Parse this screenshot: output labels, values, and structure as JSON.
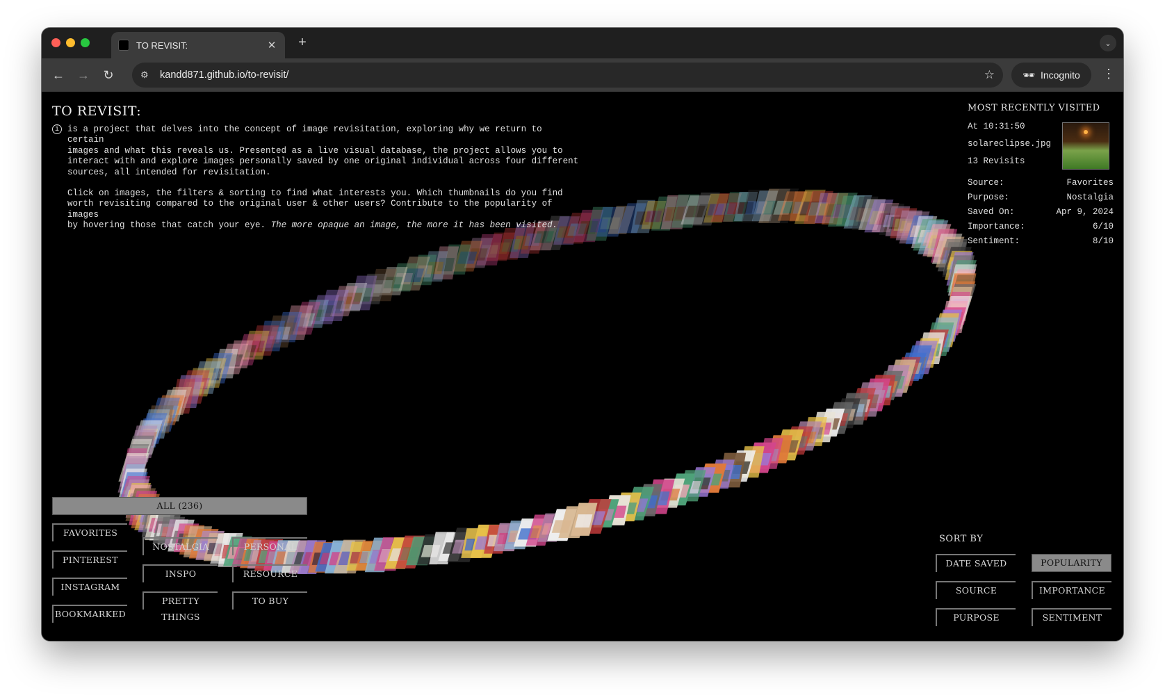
{
  "browser": {
    "tab_title": "TO REVISIT:",
    "url": "kandd871.github.io/to-revisit/",
    "incognito_label": "Incognito",
    "icons": [
      "close-icon",
      "plus-icon",
      "chevron-down-icon",
      "back-arrow-icon",
      "forward-arrow-icon",
      "reload-icon",
      "site-info-icon",
      "star-icon",
      "incognito-icon",
      "kebab-menu-icon"
    ]
  },
  "page": {
    "title": "TO REVISIT:",
    "intro_p1": "is a project that delves into the concept of image revisitation, exploring why we return to certain\nimages and what this reveals us. Presented as a live visual database, the project allows you to\ninteract with and explore images personally saved by one original individual across four different\nsources, all intended for revisitation.",
    "intro_p2": "Click on images, the filters & sorting to find what interests you. Which thumbnails do you find\nworth revisiting compared to the original user & other users? Contribute to the popularity of images\nby hovering those that catch your eye.",
    "intro_p2_italic": "The more opaque an image, the more it has been visited."
  },
  "recent": {
    "heading": "MOST RECENTLY VISITED",
    "time": "At 10:31:50",
    "filename": "solareclipse.jpg",
    "revisits": "13 Revisits",
    "fields": [
      {
        "label": "Source:",
        "value": "Favorites"
      },
      {
        "label": "Purpose:",
        "value": "Nostalgia"
      },
      {
        "label": "Saved On:",
        "value": "Apr 9, 2024"
      },
      {
        "label": "Importance:",
        "value": "6/10"
      },
      {
        "label": "Sentiment:",
        "value": "8/10"
      }
    ]
  },
  "filters": {
    "all": "ALL (236)",
    "sources": [
      "FAVORITES",
      "PINTEREST",
      "INSTAGRAM",
      "BOOKMARKED"
    ],
    "purposes": [
      "NOSTALGIA",
      "PERSONAL",
      "INSPO",
      "RESOURCE",
      "PRETTY THINGS",
      "TO BUY"
    ]
  },
  "sort": {
    "heading": "SORT BY",
    "options": [
      "DATE SAVED",
      "POPULARITY",
      "SOURCE",
      "IMPORTANCE",
      "PURPOSE",
      "SENTIMENT"
    ],
    "active": "POPULARITY"
  },
  "colors": {
    "tabstrip": "#1f1f1f",
    "toolbar": "#3b3b3b",
    "omnibox": "#282828",
    "page_bg": "#000000",
    "active_button": "#8a8a8a",
    "traffic_red": "#ff5f57",
    "traffic_yellow": "#febc2e",
    "traffic_green": "#28c840",
    "thumbnail_palette": [
      "#d4468c",
      "#e9e4d8",
      "#3f6fd1",
      "#c23b3b",
      "#e8c24a",
      "#7a5a3c",
      "#9d7bd8",
      "#4fa37a",
      "#f0f0f0",
      "#2b2b2b",
      "#e07a3a",
      "#8fb8d8",
      "#b58ab0",
      "#d9b892",
      "#6a6a6a",
      "#f2a6b8"
    ]
  }
}
